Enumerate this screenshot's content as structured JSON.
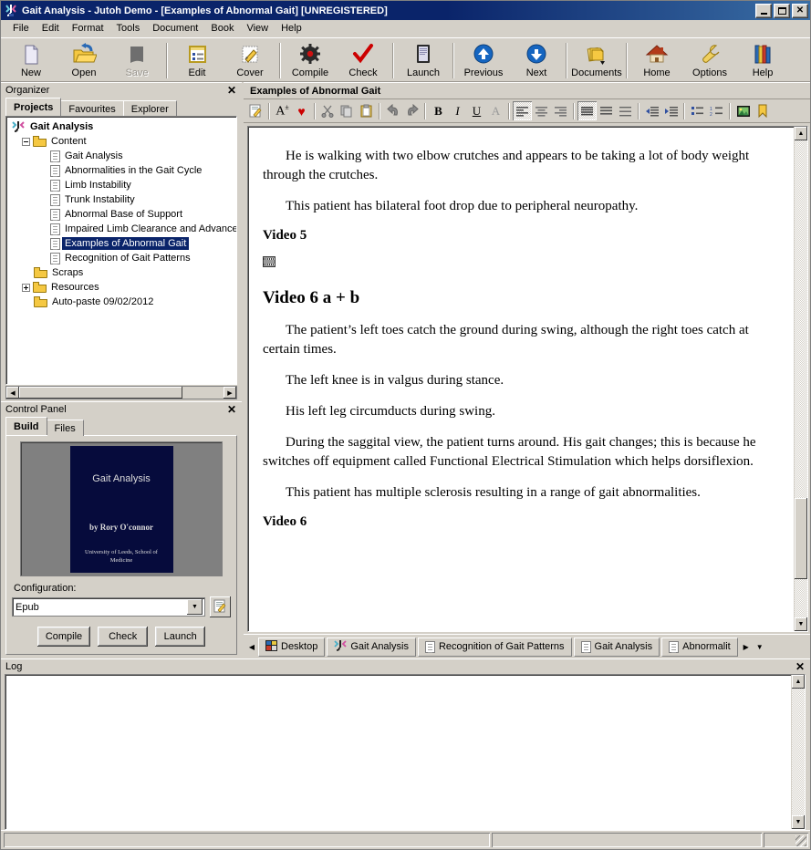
{
  "window": {
    "title": "Gait Analysis - Jutoh Demo - [Examples of Abnormal Gait] [UNREGISTERED]",
    "minimize_label": "_",
    "maximize_label": "□",
    "close_label": "✕"
  },
  "menu": [
    {
      "label": "File"
    },
    {
      "label": "Edit"
    },
    {
      "label": "Format"
    },
    {
      "label": "Tools"
    },
    {
      "label": "Document"
    },
    {
      "label": "Book"
    },
    {
      "label": "View"
    },
    {
      "label": "Help"
    }
  ],
  "toolbar": [
    {
      "label": "New",
      "icon": "new-document-icon",
      "enabled": true
    },
    {
      "label": "Open",
      "icon": "open-folder-icon",
      "enabled": true
    },
    {
      "label": "Save",
      "icon": "save-disk-icon",
      "enabled": false
    },
    {
      "sep": true
    },
    {
      "label": "Edit",
      "icon": "edit-list-icon",
      "enabled": true
    },
    {
      "label": "Cover",
      "icon": "cover-pencil-icon",
      "enabled": true
    },
    {
      "sep": true
    },
    {
      "label": "Compile",
      "icon": "gear-icon",
      "enabled": true
    },
    {
      "label": "Check",
      "icon": "checkmark-icon",
      "enabled": true
    },
    {
      "sep": true
    },
    {
      "label": "Launch",
      "icon": "launch-reader-icon",
      "enabled": true
    },
    {
      "sep": true
    },
    {
      "label": "Previous",
      "icon": "arrow-up-icon",
      "enabled": true
    },
    {
      "label": "Next",
      "icon": "arrow-down-icon",
      "enabled": true
    },
    {
      "sep": true
    },
    {
      "label": "Documents",
      "icon": "documents-stack-icon",
      "enabled": true
    },
    {
      "sep": true
    },
    {
      "label": "Home",
      "icon": "home-icon",
      "enabled": true
    },
    {
      "label": "Options",
      "icon": "wrench-icon",
      "enabled": true
    },
    {
      "label": "Help",
      "icon": "books-icon",
      "enabled": true
    }
  ],
  "organizer": {
    "caption": "Organizer",
    "close_label": "✕",
    "tabs": [
      {
        "label": "Projects",
        "active": true
      },
      {
        "label": "Favourites",
        "active": false
      },
      {
        "label": "Explorer",
        "active": false
      }
    ],
    "tree": [
      {
        "label": "Gait Analysis",
        "indent": 0,
        "icon": "jutoh-project-icon",
        "twist": "none",
        "root": true
      },
      {
        "label": "Content",
        "indent": 1,
        "icon": "folder-icon",
        "twist": "minus"
      },
      {
        "label": "Gait Analysis",
        "indent": 2,
        "icon": "document-icon",
        "twist": "none"
      },
      {
        "label": "Abnormalities in the Gait Cycle",
        "indent": 2,
        "icon": "document-icon",
        "twist": "none"
      },
      {
        "label": "Limb Instability",
        "indent": 2,
        "icon": "document-icon",
        "twist": "none"
      },
      {
        "label": "Trunk Instability",
        "indent": 2,
        "icon": "document-icon",
        "twist": "none"
      },
      {
        "label": "Abnormal Base of Support",
        "indent": 2,
        "icon": "document-icon",
        "twist": "none"
      },
      {
        "label": "Impaired Limb Clearance and Advancement",
        "indent": 2,
        "icon": "document-icon",
        "twist": "none"
      },
      {
        "label": "Examples of Abnormal Gait",
        "indent": 2,
        "icon": "document-icon",
        "twist": "none",
        "selected": true
      },
      {
        "label": "Recognition of Gait Patterns",
        "indent": 2,
        "icon": "document-icon",
        "twist": "none"
      },
      {
        "label": "Scraps",
        "indent": 1,
        "icon": "folder-icon",
        "twist": "none"
      },
      {
        "label": "Resources",
        "indent": 1,
        "icon": "folder-icon",
        "twist": "plus"
      },
      {
        "label": "Auto-paste 09/02/2012",
        "indent": 1,
        "icon": "folder-icon",
        "twist": "none"
      }
    ]
  },
  "control_panel": {
    "caption": "Control Panel",
    "close_label": "✕",
    "tabs": [
      {
        "label": "Build",
        "active": true
      },
      {
        "label": "Files",
        "active": false
      }
    ],
    "cover": {
      "title": "Gait Analysis",
      "author": "by Rory O'connor",
      "organisation": "University of Leeds, School of Medicine"
    },
    "configuration_label": "Configuration:",
    "configuration_value": "Epub",
    "edit_config_icon": "edit-config-icon",
    "buttons": [
      {
        "label": "Compile"
      },
      {
        "label": "Check"
      },
      {
        "label": "Launch"
      }
    ]
  },
  "editor": {
    "document_title": "Examples of Abnormal Gait",
    "format_toolbar": [
      {
        "icon": "edit-properties-icon",
        "pressed": false
      },
      {
        "sep": true
      },
      {
        "icon": "font-size-icon",
        "pressed": false
      },
      {
        "icon": "favourite-heart-icon",
        "pressed": false
      },
      {
        "sep": true
      },
      {
        "icon": "cut-scissors-icon",
        "pressed": false
      },
      {
        "icon": "copy-icon",
        "pressed": false
      },
      {
        "icon": "paste-icon",
        "pressed": false
      },
      {
        "sep": true
      },
      {
        "icon": "undo-icon",
        "pressed": false
      },
      {
        "icon": "redo-icon",
        "pressed": false
      },
      {
        "sep": true
      },
      {
        "icon": "bold-icon",
        "pressed": false
      },
      {
        "icon": "italic-icon",
        "pressed": false
      },
      {
        "icon": "underline-icon",
        "pressed": false
      },
      {
        "icon": "font-colour-icon",
        "pressed": false
      },
      {
        "sep": true
      },
      {
        "icon": "align-left-icon",
        "pressed": true
      },
      {
        "icon": "align-centre-icon",
        "pressed": false
      },
      {
        "icon": "align-right-icon",
        "pressed": false
      },
      {
        "sep": true
      },
      {
        "icon": "line-spacing-single-icon",
        "pressed": true
      },
      {
        "icon": "line-spacing-one-half-icon",
        "pressed": false
      },
      {
        "icon": "line-spacing-double-icon",
        "pressed": false
      },
      {
        "sep": true
      },
      {
        "icon": "indent-decrease-icon",
        "pressed": false
      },
      {
        "icon": "indent-increase-icon",
        "pressed": false
      },
      {
        "sep": true
      },
      {
        "icon": "bullet-list-icon",
        "pressed": false
      },
      {
        "icon": "numbered-list-icon",
        "pressed": false
      },
      {
        "sep": true
      },
      {
        "icon": "insert-image-icon",
        "pressed": false
      },
      {
        "icon": "bookmark-icon",
        "pressed": false
      }
    ],
    "content": [
      {
        "type": "p",
        "text": "He is walking with two elbow crutches and appears to be taking a lot of body weight through the crutches."
      },
      {
        "type": "p",
        "text": "This patient has bilateral foot drop due to peripheral neuropathy."
      },
      {
        "type": "h3",
        "text": "Video 5"
      },
      {
        "type": "media",
        "icon": "film-strip-icon"
      },
      {
        "type": "h2",
        "text": "Video 6 a + b"
      },
      {
        "type": "p",
        "text": "The patient’s left toes catch the ground during swing, although the right toes catch at certain times."
      },
      {
        "type": "p",
        "text": "The left knee is in valgus during stance."
      },
      {
        "type": "p",
        "text": "His left leg circumducts during swing."
      },
      {
        "type": "p",
        "text": "During the saggital view, the patient turns around. His gait changes; this is because he switches off equipment called Functional Electrical Stimulation which helps dorsiflexion."
      },
      {
        "type": "p",
        "text": "This patient has multiple sclerosis resulting in a range of gait abnormalities."
      },
      {
        "type": "h3",
        "text": "Video 6"
      }
    ],
    "scrollbar": {
      "up_glyph": "▲",
      "down_glyph": "▼",
      "thumb_top_pct": 75,
      "thumb_height_pct": 17
    },
    "doc_tabs": {
      "left_arrow": "◀",
      "right_arrow": "▶",
      "dropdown_arrow": "▼",
      "items": [
        {
          "label": "Desktop",
          "icon": "desktop-icon"
        },
        {
          "label": "Gait Analysis",
          "icon": "jutoh-project-icon"
        },
        {
          "label": "Recognition of Gait Patterns",
          "icon": "document-icon"
        },
        {
          "label": "Gait Analysis",
          "icon": "document-icon"
        },
        {
          "label": "Abnormalit",
          "icon": "document-icon"
        }
      ]
    }
  },
  "log": {
    "caption": "Log",
    "close_label": "✕",
    "text": "",
    "scrollbar": {
      "up_glyph": "▲",
      "down_glyph": "▼"
    }
  },
  "statusbar": {
    "field1": "",
    "field2": "",
    "field3": ""
  }
}
